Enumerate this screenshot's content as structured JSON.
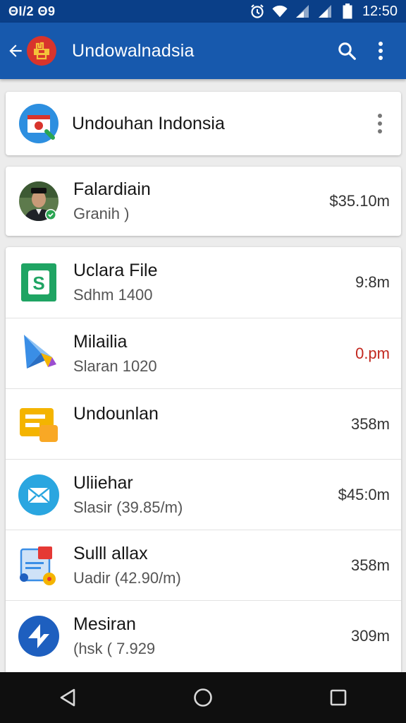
{
  "status_bar": {
    "left_text": "ΘI/2 Θ9",
    "time": "12:50",
    "icons": [
      "alarm-icon",
      "wifi-icon",
      "signal-icon",
      "signal-icon",
      "battery-icon"
    ]
  },
  "app_bar": {
    "title": "Undowalnadsia",
    "back_icon": "arrow-back-icon",
    "logo_icon": "app-logo-icon",
    "actions": [
      "search-icon",
      "more-vert-icon"
    ],
    "color": "#1759ad"
  },
  "header_card": {
    "title": "Undouhan Indonsia",
    "icon": "calendar-logo-icon",
    "menu_icon": "more-vert-icon"
  },
  "profile_card": {
    "name": "Falardiain",
    "subtitle": "Granih )",
    "value": "$35.10m",
    "icon": "avatar-verified-icon"
  },
  "list": {
    "items": [
      {
        "title": "Uclara File",
        "sub": "Sdhm 1400",
        "value": "9:8m",
        "icon": "sheets-icon",
        "value_color": "#333333"
      },
      {
        "title": "Milailia",
        "sub": "Slaran 1020",
        "value": "0.pm",
        "icon": "maps-kite-icon",
        "value_color": "#c2271e"
      },
      {
        "title": "Undounlan",
        "sub": "",
        "value": "358m",
        "icon": "slides-icon",
        "value_color": "#333333"
      },
      {
        "title": "Uliiehar",
        "sub": "Slasir (39.85/m)",
        "value": "$45:0m",
        "icon": "mail-icon",
        "value_color": "#333333"
      },
      {
        "title": "Sulll allax",
        "sub": "Uadir (42.90/m)",
        "value": "358m",
        "icon": "document-icon",
        "value_color": "#333333"
      },
      {
        "title": "Mesiran",
        "sub": "(hsk ( 7.929",
        "value": "309m",
        "icon": "navigate-icon",
        "value_color": "#333333"
      }
    ]
  },
  "nav_bar": {
    "buttons": [
      "back-triangle-icon",
      "home-circle-icon",
      "recents-square-icon"
    ]
  }
}
